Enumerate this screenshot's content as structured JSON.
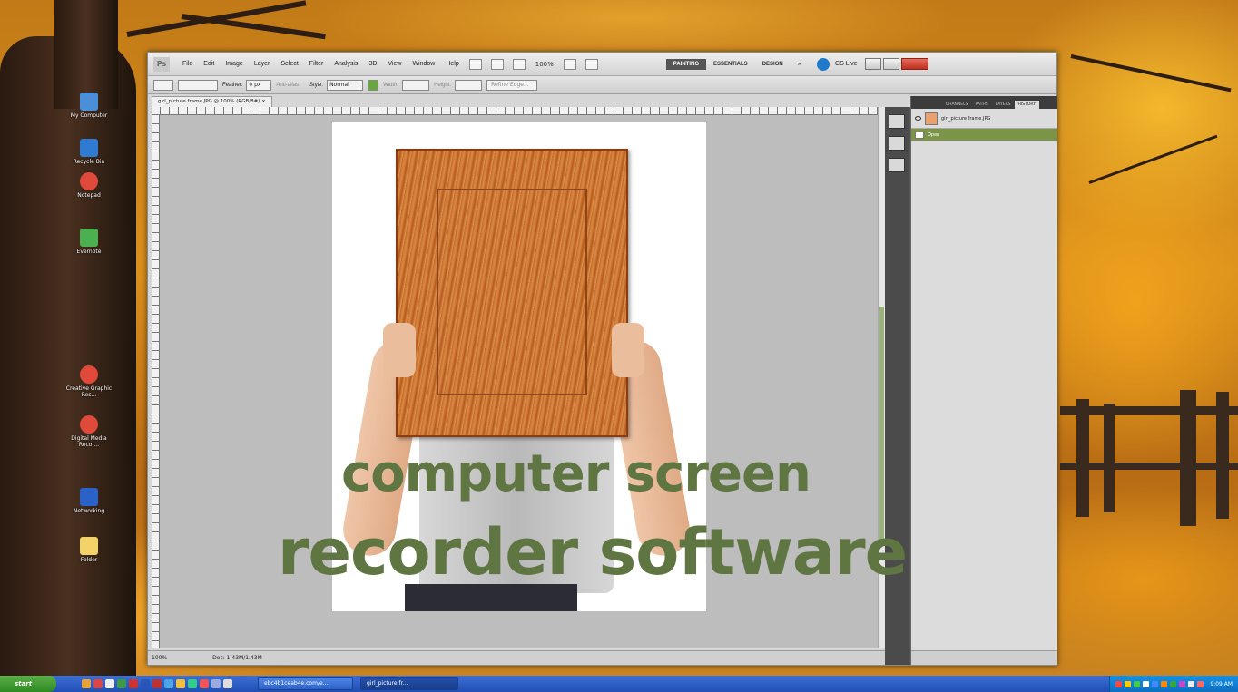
{
  "caption": {
    "line1": "computer screen",
    "line2": "recorder software",
    "color": "#5f7642"
  },
  "desktop": {
    "icons": [
      {
        "label": "My Computer",
        "color": "#4a8fd8"
      },
      {
        "label": "Recycle Bin",
        "color": "#2f7bd2"
      },
      {
        "label": "Notepad",
        "color": "#35a04a"
      },
      {
        "label": "Evernote",
        "color": "#4caf50"
      },
      {
        "label": "Creative Graphic Res...",
        "color": "#e04a3a"
      },
      {
        "label": "Digital Media Recor...",
        "color": "#e04a3a"
      },
      {
        "label": "Networking",
        "color": "#2a62c8"
      },
      {
        "label": "Folder",
        "color": "#f3d26a"
      }
    ]
  },
  "photoshop": {
    "logo": "Ps",
    "menus": [
      "File",
      "Edit",
      "Image",
      "Layer",
      "Select",
      "Filter",
      "Analysis",
      "3D",
      "View",
      "Window",
      "Help"
    ],
    "zoom_label": "100%",
    "workspaces": [
      "PAINTING",
      "ESSENTIALS",
      "DESIGN",
      "»"
    ],
    "cs_live": "CS Live",
    "options": {
      "feather_label": "Feather:",
      "feather_value": "0 px",
      "anti_alias": "Anti-alias",
      "style_label": "Style:",
      "style_value": "Normal",
      "width_label": "Width:",
      "height_label": "Height:",
      "refine_edge": "Refine Edge..."
    },
    "document_tab": "girl_picture frame.JPG @ 100% (RGB/8#) ×",
    "status": {
      "zoom": "100%",
      "doc_size": "Doc: 1.43M/1.43M"
    },
    "layers_panel": {
      "tabs": [
        "CHANNELS",
        "PATHS",
        "LAYERS",
        "HISTORY"
      ],
      "layers": [
        {
          "name": "girl_picture frame.JPG",
          "selected": false
        },
        {
          "name": "Open",
          "selected": true
        }
      ]
    }
  },
  "taskbar": {
    "start_label": "start",
    "tasks": [
      {
        "label": "ebc4b1ceab4e.com/e...",
        "active": false
      },
      {
        "label": "girl_picture fr...",
        "active": true
      }
    ],
    "clock": "9:09 AM"
  }
}
